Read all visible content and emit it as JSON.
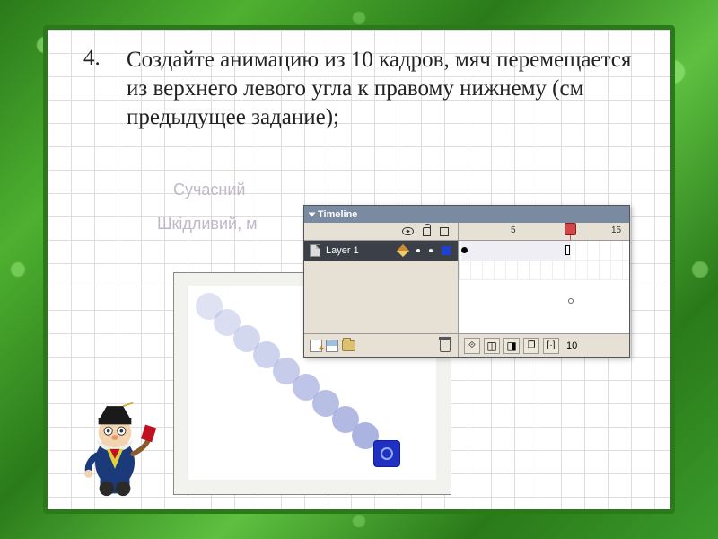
{
  "task": {
    "number": "4.",
    "text": "Создайте анимацию из 10 кадров, мяч перемещается из верхнего левого угла к правому нижнему (см предыдущее задание);"
  },
  "faded_lines": {
    "line1": "Сучасний",
    "line2": "Шкідливий, м"
  },
  "timeline": {
    "title": "Timeline",
    "layer_name": "Layer 1",
    "ruler": {
      "t5": "5",
      "t10": "",
      "t15": "15"
    },
    "current_frame": "10"
  },
  "icons": {
    "eye": "eye-icon",
    "lock": "lock-icon",
    "outline": "square-icon",
    "trash": "trash-icon",
    "add_layer": "add-layer-icon",
    "add_guide": "add-guide-icon",
    "add_folder": "add-folder-icon"
  }
}
